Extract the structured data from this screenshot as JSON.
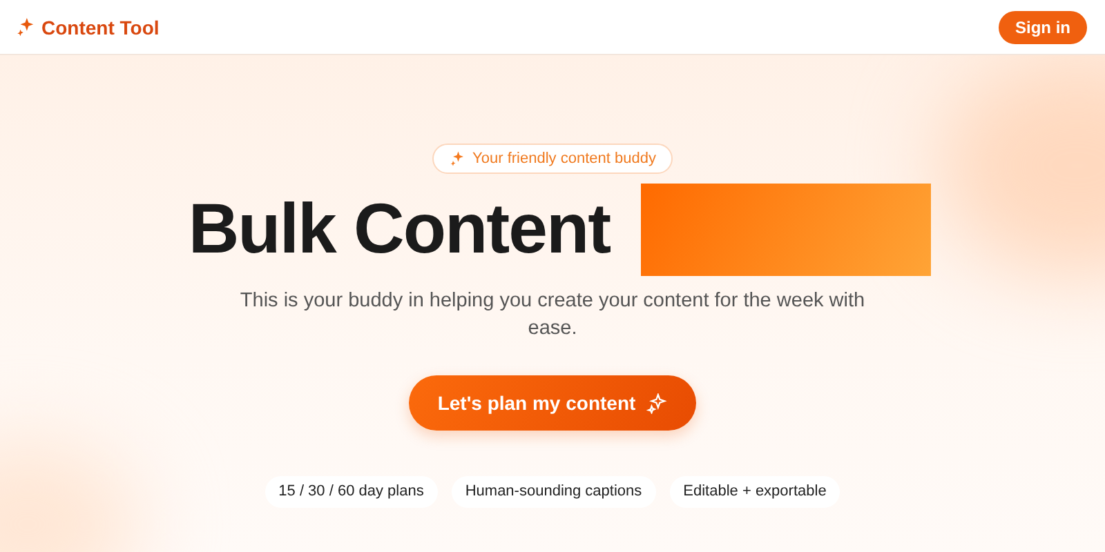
{
  "header": {
    "logo": "Content Tool",
    "sign_in": "Sign in"
  },
  "hero": {
    "badge": "Your friendly content buddy",
    "title": "Bulk Content",
    "subtitle": "This is your buddy in helping you create your content for the week with ease.",
    "cta": "Let's plan my content",
    "features": [
      "15 / 30 / 60 day plans",
      "Human-sounding captions",
      "Editable + exportable"
    ]
  }
}
